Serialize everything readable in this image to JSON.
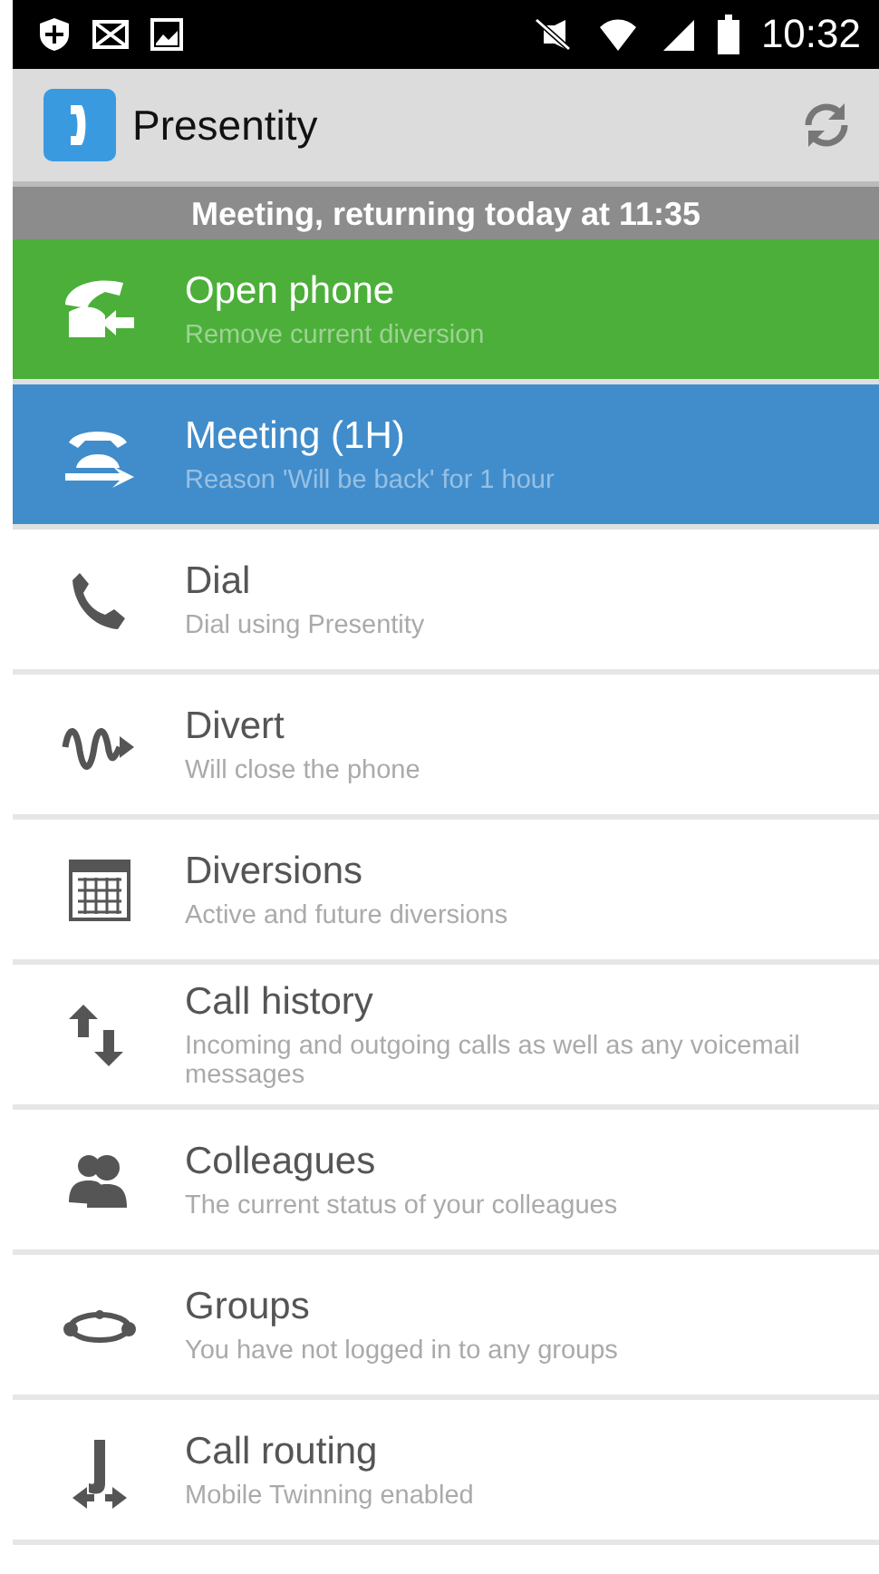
{
  "status_bar": {
    "time": "10:32"
  },
  "app_bar": {
    "title": "Presentity"
  },
  "banner": "Meeting, returning today at 11:35",
  "items": [
    {
      "title": "Open phone",
      "subtitle": "Remove current diversion",
      "color": "#4caf3a"
    },
    {
      "title": "Meeting (1H)",
      "subtitle": "Reason 'Will be back' for 1 hour",
      "color": "#418dcc"
    },
    {
      "title": "Dial",
      "subtitle": "Dial using Presentity"
    },
    {
      "title": "Divert",
      "subtitle": "Will close the phone"
    },
    {
      "title": "Diversions",
      "subtitle": "Active and future diversions"
    },
    {
      "title": "Call history",
      "subtitle": "Incoming and outgoing calls as well as any voicemail messages"
    },
    {
      "title": "Colleagues",
      "subtitle": "The current status of your colleagues"
    },
    {
      "title": "Groups",
      "subtitle": "You have not logged in to any groups"
    },
    {
      "title": "Call routing",
      "subtitle": "Mobile Twinning enabled"
    }
  ]
}
